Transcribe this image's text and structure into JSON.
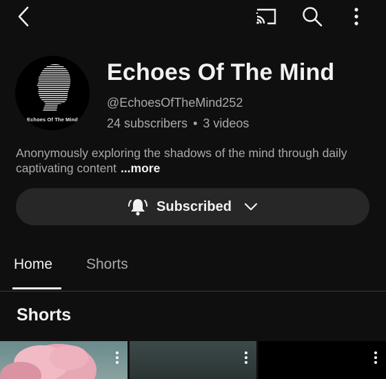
{
  "channel": {
    "name": "Echoes Of The Mind",
    "handle": "@EchoesOfTheMind252",
    "subscribers": "24 subscribers",
    "separator": "•",
    "videos": "3 videos",
    "avatar_text": "Echoes Of The Mind",
    "description": "Anonymously exploring the shadows of the mind through daily captivating content",
    "more_label": "...more"
  },
  "subscribe_button": {
    "label": "Subscribed"
  },
  "tabs": [
    {
      "label": "Home",
      "active": true
    },
    {
      "label": "Shorts",
      "active": false
    }
  ],
  "section": {
    "title": "Shorts"
  },
  "icons": {
    "back": "back-arrow-icon",
    "cast": "cast-icon",
    "search": "search-icon",
    "more": "more-vertical-icon"
  }
}
